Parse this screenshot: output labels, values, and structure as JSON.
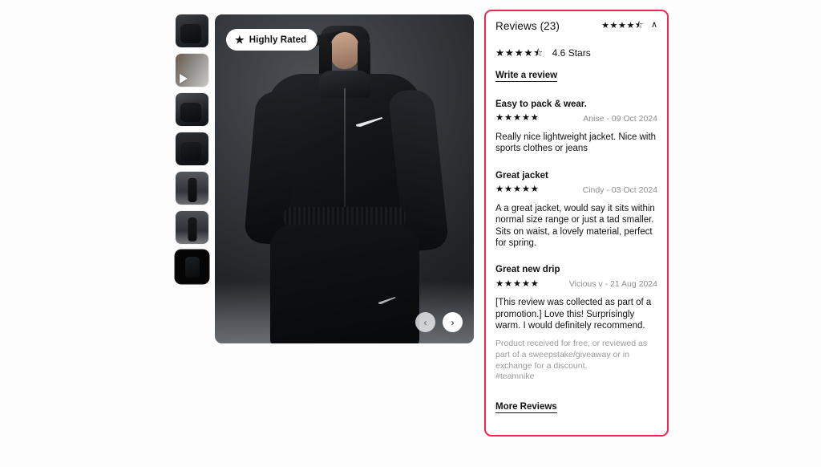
{
  "gallery": {
    "badge": {
      "label": "Highly Rated",
      "icon": "star-icon"
    },
    "thumbnails": [
      {
        "alt": "Model wearing black jacket, three-quarter view",
        "type": "image",
        "selected": false
      },
      {
        "alt": "Video of product detail",
        "type": "video",
        "selected": false
      },
      {
        "alt": "Model in black cap and jacket, side view",
        "type": "image",
        "selected": false
      },
      {
        "alt": "Close up of black jacket sleeve",
        "type": "image",
        "selected": false
      },
      {
        "alt": "Full body front view of black outfit",
        "type": "image",
        "selected": false
      },
      {
        "alt": "Full body back view of black outfit",
        "type": "image",
        "selected": false
      },
      {
        "alt": "Jacket flat lay on black background",
        "type": "image",
        "selected": true
      }
    ],
    "nav": {
      "prev_icon": "chevron-left-icon",
      "next_icon": "chevron-right-icon",
      "prev_label": "‹",
      "next_label": "›"
    }
  },
  "reviews": {
    "title": "Reviews (23)",
    "header_stars": "★★★★⯪",
    "collapse_icon": "chevron-up-icon",
    "collapse_label": "∧",
    "summary_stars": "★★★★⯪",
    "summary_label": "4.6 Stars",
    "write_review_label": "Write a review",
    "more_reviews_label": "More Reviews",
    "accent_color": "#f5254e",
    "items": [
      {
        "heading": "Easy to pack & wear.",
        "stars": "★★★★★",
        "author": "Anise - 09 Oct 2024",
        "body": "Really nice lightweight jacket. Nice with sports clothes or jeans"
      },
      {
        "heading": "Great jacket",
        "stars": "★★★★★",
        "author": "Cindy - 03 Oct 2024",
        "body": "A a great jacket, would say it sits within normal size range or just a tad smaller. Sits on waist, a lovely material, perfect for spring."
      },
      {
        "heading": "Great new drip",
        "stars": "★★★★★",
        "author": "Vicious v - 21 Aug 2024",
        "body": "[This review was collected as part of a promotion.] Love this! Surprisingly warm. I would definitely recommend.",
        "disclaimer": "Product received for free, or reviewed as part of a sweepstake/giveaway or in exchange for a discount.",
        "tag": "#teamnike"
      }
    ]
  }
}
